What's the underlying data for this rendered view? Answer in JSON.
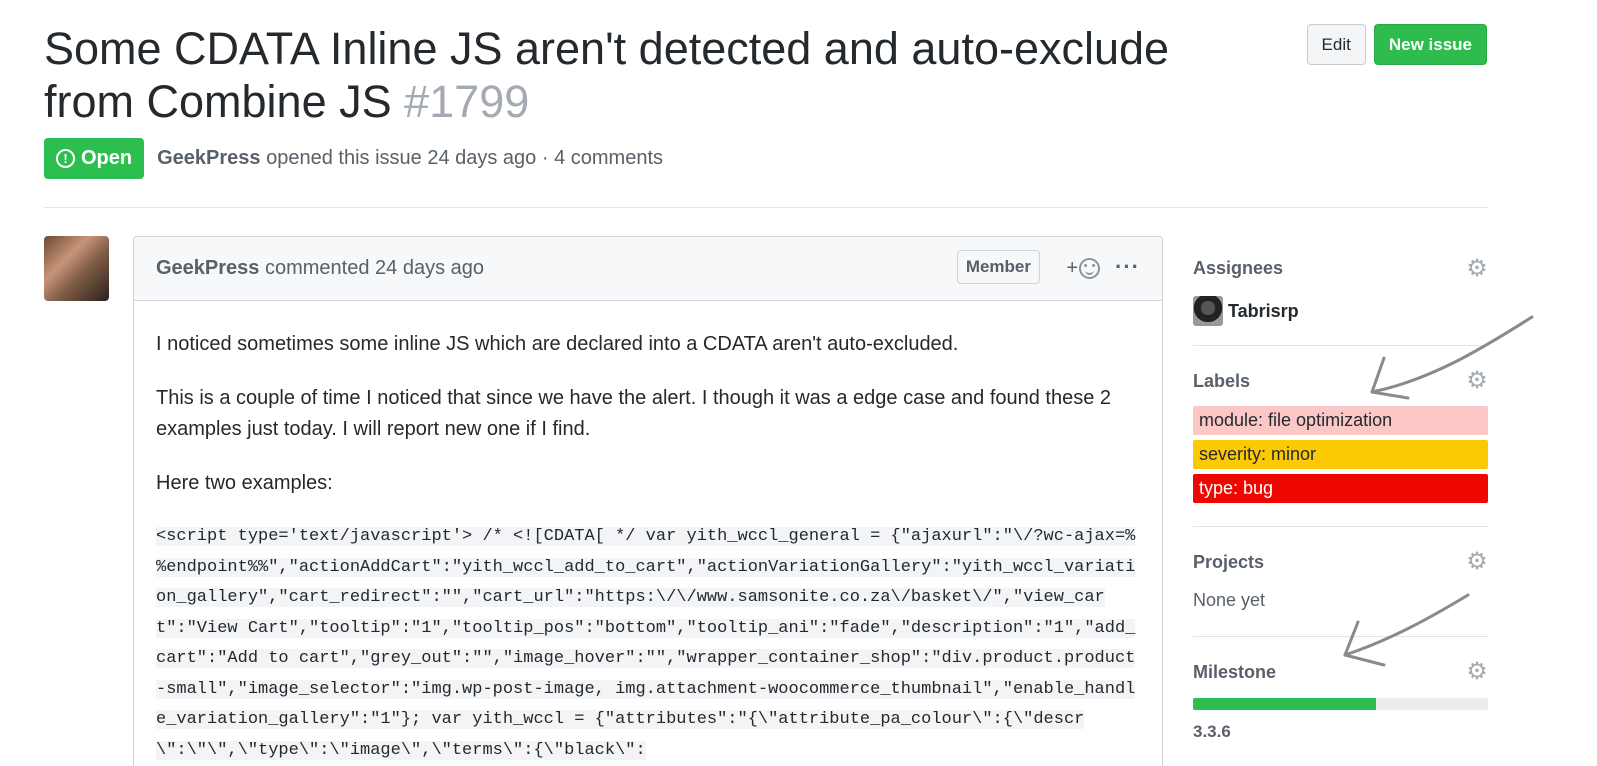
{
  "issue": {
    "title": "Some CDATA Inline JS aren't detected and auto-exclude from Combine JS",
    "number": "#1799",
    "state": "Open",
    "author": "GeekPress",
    "meta_text": "opened this issue 24 days ago · 4 comments"
  },
  "header": {
    "edit_label": "Edit",
    "new_issue_label": "New issue"
  },
  "comment": {
    "author": "GeekPress",
    "action": "commented 24 days ago",
    "badge": "Member",
    "reaction_plus": "+",
    "more": "···",
    "paragraphs": [
      "I noticed sometimes some inline JS which are declared into a CDATA aren't auto-excluded.",
      "This is a couple of time I noticed that since we have the alert. I though it was a edge case and found these 2 examples just today. I will report new one if I find.",
      "Here two examples:"
    ],
    "code": " <script type='text/javascript'> /* <![CDATA[ */ var yith_wccl_general = {\"ajaxurl\":\"\\/?wc-ajax=%%endpoint%%\",\"actionAddCart\":\"yith_wccl_add_to_cart\",\"actionVariationGallery\":\"yith_wccl_variation_gallery\",\"cart_redirect\":\"\",\"cart_url\":\"https:\\/\\/www.samsonite.co.za\\/basket\\/\",\"view_cart\":\"View Cart\",\"tooltip\":\"1\",\"tooltip_pos\":\"bottom\",\"tooltip_ani\":\"fade\",\"description\":\"1\",\"add_cart\":\"Add to cart\",\"grey_out\":\"\",\"image_hover\":\"\",\"wrapper_container_shop\":\"div.product.product-small\",\"image_selector\":\"img.wp-post-image, img.attachment-woocommerce_thumbnail\",\"enable_handle_variation_gallery\":\"1\"}; var yith_wccl = {\"attributes\":\"{\\\"attribute_pa_colour\\\":{\\\"descr\\\":\\\"\\\",\\\"type\\\":\\\"image\\\",\\\"terms\\\":{\\\"black\\\":"
  },
  "sidebar": {
    "assignees_heading": "Assignees",
    "assignee_name": "Tabrisrp",
    "labels_heading": "Labels",
    "labels": [
      {
        "text": "module: file optimization",
        "bg": "#fcc7c7",
        "fg": "#24292e"
      },
      {
        "text": "severity: minor",
        "bg": "#fbca04",
        "fg": "#24292e"
      },
      {
        "text": "type: bug",
        "bg": "#ee0701",
        "fg": "#ffffff"
      }
    ],
    "projects_heading": "Projects",
    "projects_value": "None yet",
    "milestone_heading": "Milestone",
    "milestone_progress": 0.62,
    "milestone_name": "3.3.6"
  },
  "colors": {
    "open_green": "#2cbe4e",
    "new_issue_green": "#2ebc4f"
  },
  "icons": [
    "issue-opened-icon",
    "smiley-icon",
    "kebab-icon",
    "gear-icon"
  ]
}
